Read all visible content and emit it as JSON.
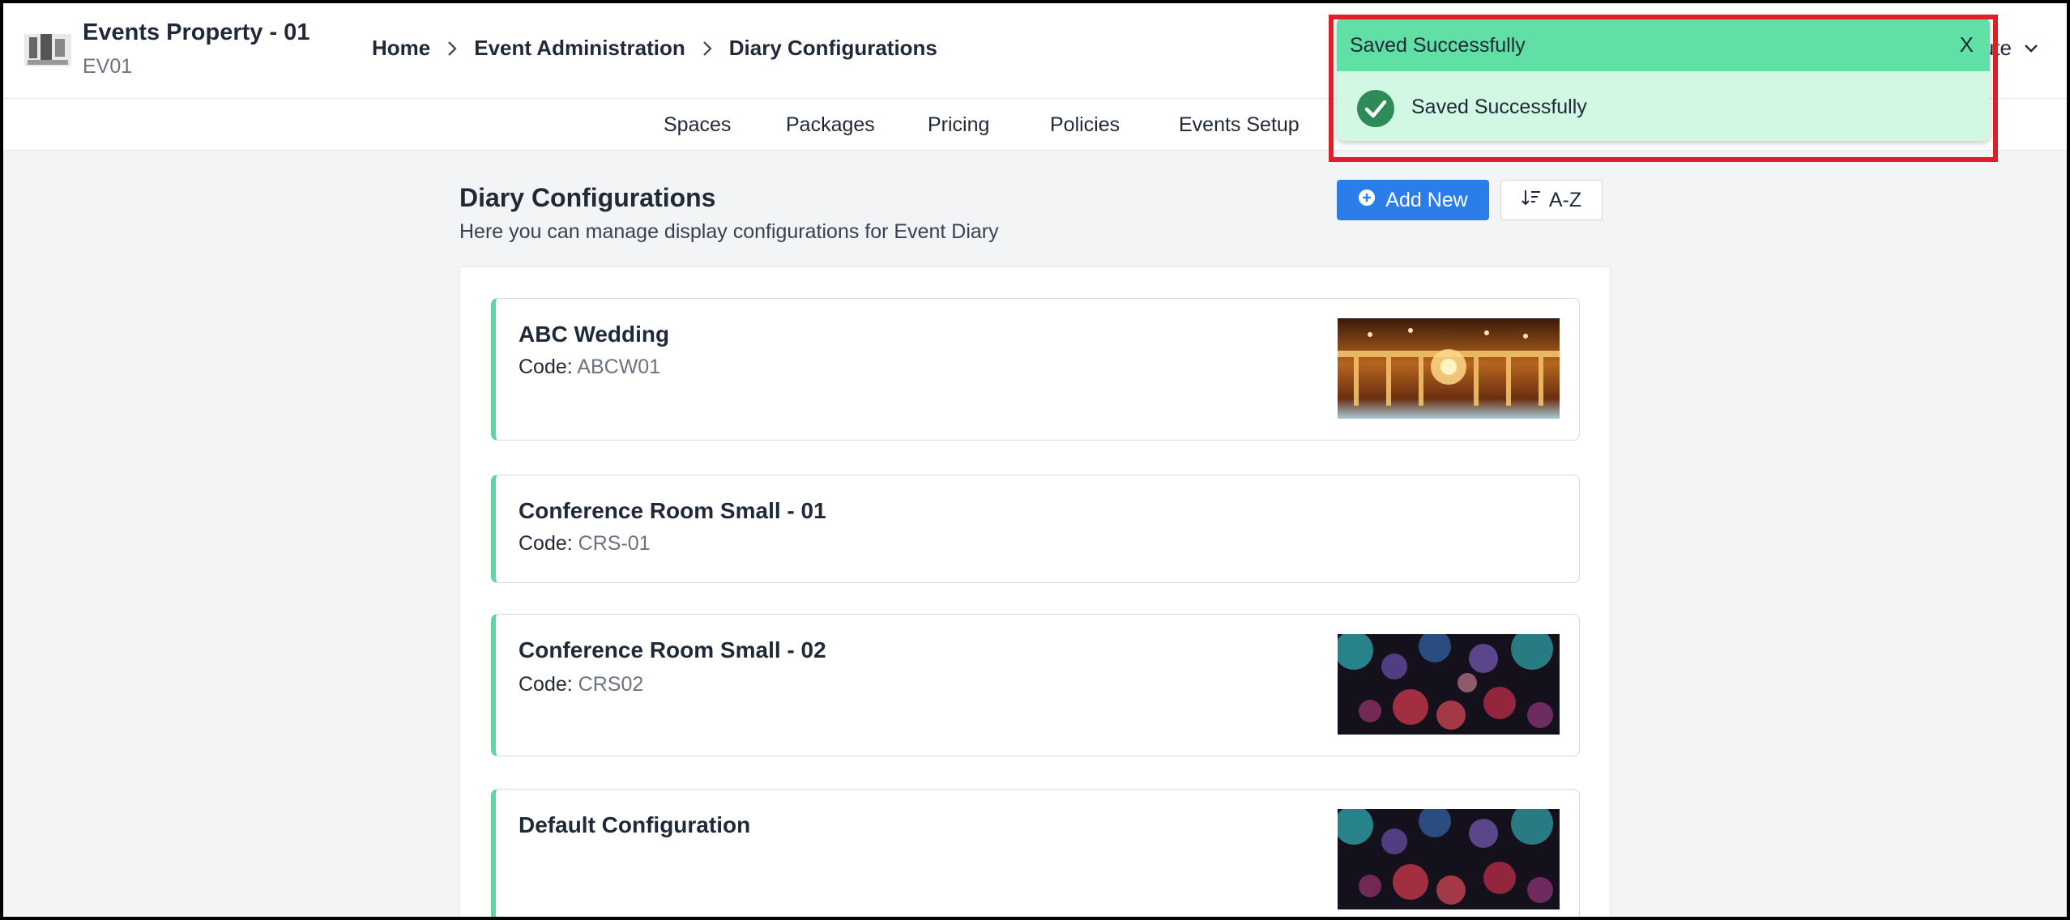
{
  "header": {
    "property_name": "Events Property - 01",
    "property_code": "EV01",
    "breadcrumb": [
      "Home",
      "Event Administration",
      "Diary Configurations"
    ],
    "user_menu_label": "ute"
  },
  "subnav": {
    "tabs": [
      "Spaces",
      "Packages",
      "Pricing",
      "Policies",
      "Events Setup"
    ]
  },
  "page": {
    "title": "Diary Configurations",
    "subtitle": "Here you can manage display configurations for Event Diary",
    "add_new_label": "Add New",
    "sort_label": "A-Z"
  },
  "configurations": [
    {
      "name": "ABC Wedding",
      "code_label": "Code:",
      "code": "ABCW01",
      "image": "wedding-hall"
    },
    {
      "name": "Conference Room Small - 01",
      "code_label": "Code:",
      "code": "CRS-01",
      "image": ""
    },
    {
      "name": "Conference Room Small - 02",
      "code_label": "Code:",
      "code": "CRS02",
      "image": "bokeh-lights"
    },
    {
      "name": "Default Configuration",
      "code_label": "",
      "code": "",
      "image": "bokeh-lights"
    }
  ],
  "toast": {
    "title": "Saved Successfully",
    "message": "Saved Successfully",
    "close_label": "X"
  },
  "colors": {
    "primary": "#2b7de9",
    "accent_green": "#5fd6a0",
    "toast_header": "#61e0a6",
    "toast_body": "#d2f8e4",
    "success_icon": "#2e8b57",
    "highlight_outline": "#e11d2a"
  },
  "icons": {
    "breadcrumb_separator": "chevron-right-icon",
    "add_new": "plus-circle-icon",
    "sort": "sort-az-icon",
    "user_menu": "chevron-down-icon",
    "toast_status": "check-circle-icon",
    "toast_close": "close-icon"
  }
}
